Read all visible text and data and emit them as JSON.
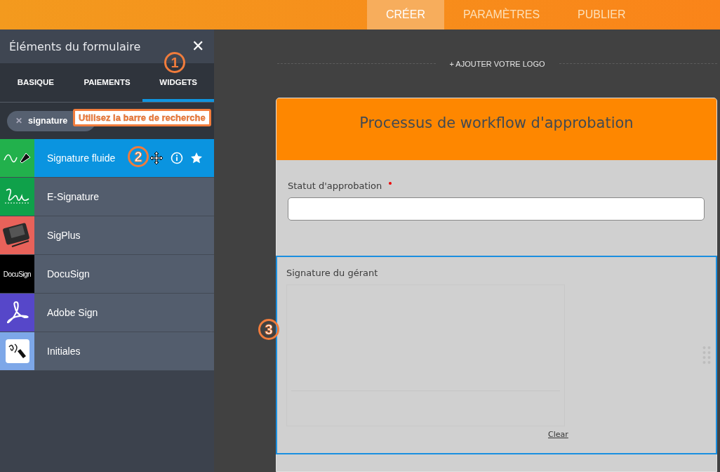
{
  "nav": {
    "tabs": [
      {
        "label": "CRÉER",
        "selected": true
      },
      {
        "label": "PARAMÈTRES",
        "selected": false
      },
      {
        "label": "PUBLIER",
        "selected": false
      }
    ]
  },
  "sidebar": {
    "title": "Éléments du formulaire",
    "close": "✕",
    "tabs": [
      {
        "label": "BASIQUE",
        "selected": false
      },
      {
        "label": "PAIEMENTS",
        "selected": false
      },
      {
        "label": "WIDGETS",
        "selected": true
      }
    ],
    "search": {
      "value": "signature",
      "clear": "✕"
    },
    "items": [
      {
        "label": "Signature fluide",
        "selected": true,
        "kind": "pen",
        "color": "#22b14c"
      },
      {
        "label": "E-Signature",
        "selected": false,
        "kind": "scribble",
        "color": "#0fa14a"
      },
      {
        "label": "SigPlus",
        "selected": false,
        "kind": "tablet",
        "color": "#e8625a"
      },
      {
        "label": "DocuSign",
        "selected": false,
        "kind": "wordmark",
        "color": "#000000",
        "logo_text": "DocuSign"
      },
      {
        "label": "Adobe Sign",
        "selected": false,
        "kind": "acrobat",
        "color": "#5647c9"
      },
      {
        "label": "Initiales",
        "selected": false,
        "kind": "initials",
        "color": "#7da7e8"
      }
    ]
  },
  "form": {
    "add_logo": "+ AJOUTER VOTRE LOGO",
    "title": "Processus de workflow d'approbation",
    "fields": [
      {
        "label": "Statut d'approbation",
        "required": true,
        "kind": "text",
        "selected": false
      },
      {
        "label": "Signature du gérant",
        "required": false,
        "kind": "signature",
        "selected": true,
        "clear": "Clear"
      }
    ]
  },
  "annotations": {
    "search_hint": "Utilisez la barre de recherche",
    "steps": [
      "1",
      "2",
      "3"
    ]
  }
}
